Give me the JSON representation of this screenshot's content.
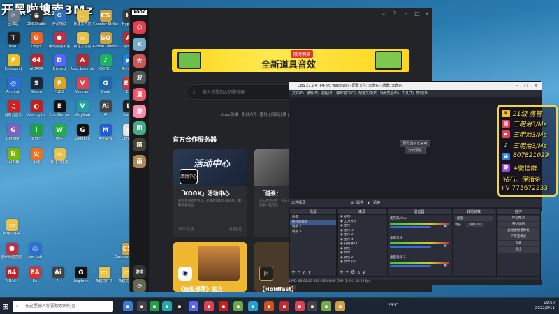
{
  "watermark": "开黑啦搜索3Mz",
  "desktop_icons": [
    {
      "label": "回收站",
      "color": "#6a7a8a",
      "glyph": "♲"
    },
    {
      "label": "OBS Studio",
      "color": "#333",
      "glyph": "◉"
    },
    {
      "label": "开源物联",
      "color": "#2d6fb8",
      "glyph": "⚙"
    },
    {
      "label": "新建文件夹",
      "color": "#e8c14a",
      "glyph": "▭"
    },
    {
      "label": "Counter-Strike",
      "color": "#d0a040",
      "glyph": "CS"
    },
    {
      "label": "Hypixel",
      "color": "#3a3a3a",
      "glyph": "H"
    },
    {
      "label": "TIDAL",
      "color": "#222",
      "glyph": "T"
    },
    {
      "label": "Origin",
      "color": "#f06020",
      "glyph": "O"
    },
    {
      "label": "腾讯网游加速",
      "color": "#c03040",
      "glyph": "⬢"
    },
    {
      "label": "新建文件夹",
      "color": "#e8c14a",
      "glyph": "▭"
    },
    {
      "label": "Global Offensive",
      "color": "#d0a040",
      "glyph": "GO"
    },
    {
      "label": "Apex",
      "color": "#c02830",
      "glyph": "A"
    },
    {
      "label": "Foxhound",
      "color": "#f0c020",
      "glyph": "F"
    },
    {
      "label": "AIDA64",
      "color": "#c02020",
      "glyph": "64"
    },
    {
      "label": "Discord",
      "color": "#5865f2",
      "glyph": "D"
    },
    {
      "label": "Apex Legends",
      "color": "#b02a30",
      "glyph": "A"
    },
    {
      "label": "QQ音乐",
      "color": "#20b060",
      "glyph": "♪"
    },
    {
      "label": "腾讯视频",
      "color": "#2080e0",
      "glyph": "▶"
    },
    {
      "label": "Aim Lab",
      "color": "#2b6fd6",
      "glyph": "◎"
    },
    {
      "label": "Steam",
      "color": "#1b2838",
      "glyph": "S"
    },
    {
      "label": "PUBG",
      "color": "#e0a020",
      "glyph": "P"
    },
    {
      "label": "Valorant",
      "color": "#e04050",
      "glyph": "V"
    },
    {
      "label": "Geek",
      "color": "#2266aa",
      "glyph": "G"
    },
    {
      "label": "EA",
      "color": "#e03030",
      "glyph": "EA"
    },
    {
      "label": "网易云音乐",
      "color": "#d02020",
      "glyph": "♫"
    },
    {
      "label": "Among Us",
      "color": "#c02020",
      "glyph": "◐"
    },
    {
      "label": "Epic Games",
      "color": "#111",
      "glyph": "E"
    },
    {
      "label": "VeryKuai",
      "color": "#20a0a0",
      "glyph": "V"
    },
    {
      "label": "Ai",
      "color": "#444",
      "glyph": "Ai"
    },
    {
      "label": "Lady",
      "color": "#222",
      "glyph": "L"
    },
    {
      "label": "Genshin",
      "color": "#8060c0",
      "glyph": "G"
    },
    {
      "label": "爱奇艺",
      "color": "#20a040",
      "glyph": "i"
    },
    {
      "label": "微信",
      "color": "#20b040",
      "glyph": "W"
    },
    {
      "label": "Logitech",
      "color": "#111",
      "glyph": "G"
    },
    {
      "label": "腾讯会议",
      "color": "#2060d0",
      "glyph": "M"
    },
    {
      "label": "Chrome",
      "color": "#e0e0e0",
      "glyph": "◍"
    },
    {
      "label": "NVIDIA",
      "color": "#76b900",
      "glyph": "N"
    },
    {
      "label": "火绒",
      "color": "#f07020",
      "glyph": "火"
    },
    {
      "label": "新建文件夹",
      "color": "#e8c14a",
      "glyph": "▭"
    }
  ],
  "kook": {
    "logo": "KOOK",
    "rail_items": [
      "K",
      "大",
      "波",
      "漫",
      "游",
      "图",
      "暗",
      "画"
    ],
    "search_placeholder": "输入你想加入的服务器",
    "tags": "Apex英雄 | 彩虹六号: 围攻 | 网络比赛 | 追",
    "section_title": "官方合作服务器",
    "banner_text": "全新道具音效",
    "banner_tag": "限时购买",
    "cards": [
      {
        "title": "「KOOK」活动中心",
        "desc": "即刻参与官方活动，抢先获取新功能体验，赢取精美周边",
        "meta": "1901 在线",
        "meta2": "有趣社区"
      },
      {
        "title": "「猎杀：",
        "desc": "加入官方社区，与众多玩家一起交流",
        "meta": "在线",
        "meta2": ""
      },
      {
        "title": "《启虫部落》官方",
        "desc": "",
        "meta": "",
        "meta2": ""
      },
      {
        "title": "【Holdfast】官方",
        "desc": "",
        "meta": "",
        "meta2": ""
      }
    ],
    "card_badge": "活动中心",
    "rail_bottom": "游戏"
  },
  "obs": {
    "title": "OBS 27.2.4 (64-bit, windows) - 配置文件: 未命名 - 场景: 未命名",
    "menu": [
      "文件(F)",
      "编辑(E)",
      "视图(V)",
      "停靠窗口(D)",
      "配置文件(P)",
      "场景集合(S)",
      "工具(T)",
      "帮助(H)"
    ],
    "preview_btn1": "预览当前已禁用",
    "preview_btn2": "开启预览",
    "source_status": "未选择源",
    "props_btn": "属性",
    "filters_btn": "滤镜",
    "docks": {
      "scenes": {
        "header": "场景",
        "items": [
          "场景",
          "图片层级组",
          "场景 2",
          "场景 3"
        ]
      },
      "sources": {
        "header": "来源",
        "items": [
          "游戏",
          "上方分割",
          "图片",
          "图片 3",
          "图片 2",
          "图片 4",
          "开屏幕14",
          "颜色",
          "文本",
          "颜色 2",
          "文本 (G)"
        ]
      },
      "mixer": {
        "header": "混音器",
        "items": [
          "麦克风/Aux",
          "桌面音频",
          "桌面音频 2"
        ]
      },
      "transitions": {
        "header": "转场特效",
        "type": "渐变",
        "duration_label": "时长",
        "duration": "300 ms"
      },
      "controls": {
        "header": "控件",
        "buttons": [
          "停止推流",
          "开始录制",
          "启动虚拟摄像机",
          "工作室模式",
          "设置",
          "退出"
        ]
      }
    },
    "status": "LIVE: 00:00:00   REC: 00:00:00   CPU: 1.6%, 60.00 fps"
  },
  "overlay": {
    "lines": [
      "21级 房管",
      "三明治3/Mz",
      "三明治3/Mz",
      "三明治3/Mz",
      "807821029",
      "+微信群",
      "钻石、保猎杀",
      "+V 775672233"
    ]
  },
  "taskbar": {
    "search_placeholder": "在这里输入你要搜索的内容",
    "weather": "23°C",
    "time": "19:50",
    "date": "2022/9/11"
  },
  "colors": {
    "obs_bg": "#2b2e38",
    "kook_bg": "#232428",
    "overlay_text": "#ffe23c",
    "accent": "#f1d34a"
  }
}
